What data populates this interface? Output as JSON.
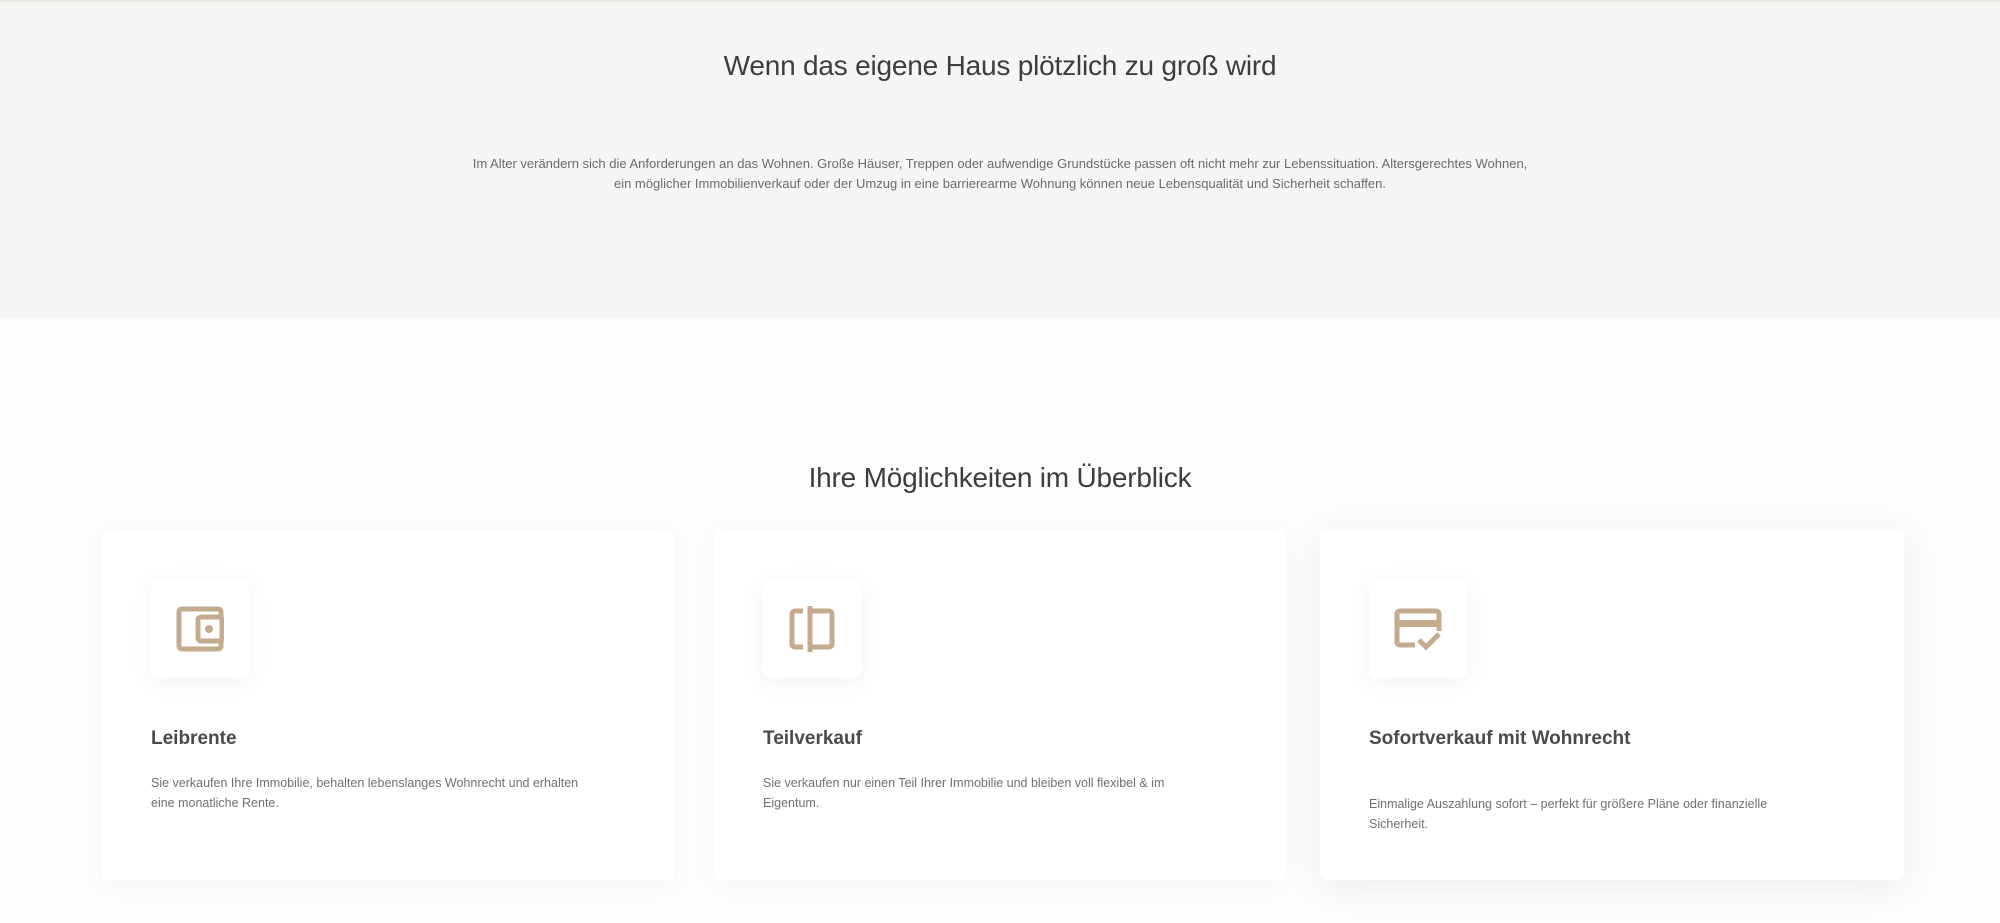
{
  "hero": {
    "title": "Wenn das eigene Haus plötzlich zu groß wird",
    "text_line1": "Im Alter verändern sich die Anforderungen an das Wohnen. Große Häuser, Treppen oder aufwendige Grundstücke passen oft nicht mehr zur Lebenssituation. Altersgerechtes Wohnen,",
    "text_line2": "ein möglicher Immobilienverkauf oder der Umzug in eine barrierearme Wohnung können neue Lebensqualität und Sicherheit schaffen."
  },
  "options": {
    "title": "Ihre Möglichkeiten im Überblick",
    "accent_color": "#c4ab8e",
    "cards": [
      {
        "icon": "wallet-icon",
        "title": "Leibrente",
        "text": "Sie verkaufen Ihre Immobilie, behalten lebenslanges Wohnrecht und erhalten eine monatliche Rente."
      },
      {
        "icon": "split-icon",
        "title": "Teilverkauf",
        "text": "Sie verkaufen nur einen Teil Ihrer Immobilie und bleiben voll flexibel & im Eigentum."
      },
      {
        "icon": "card-check-icon",
        "title": "Sofortverkauf mit Wohnrecht",
        "text": "Einmalige Auszahlung sofort – perfekt für größere Pläne oder finanzielle Sicherheit."
      }
    ]
  }
}
